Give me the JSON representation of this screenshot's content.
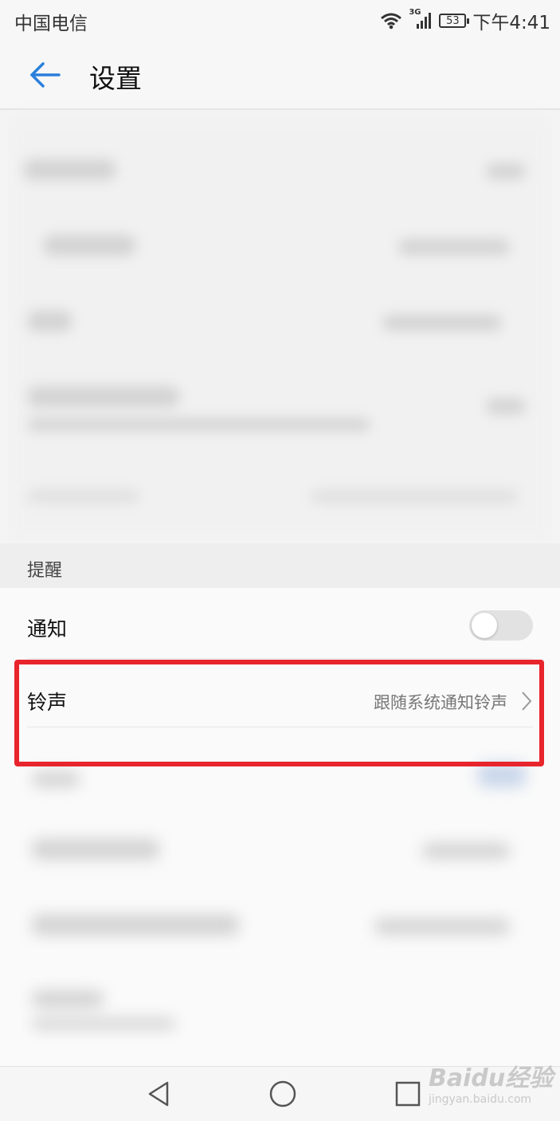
{
  "status_bar": {
    "carrier": "中国电信",
    "network": "3G",
    "battery": "53",
    "time": "下午4:41"
  },
  "header": {
    "title": "设置"
  },
  "reminders": {
    "section_label": "提醒",
    "notification_label": "通知",
    "notification_enabled": false,
    "ringtone_label": "铃声",
    "ringtone_value": "跟随系统通知铃声"
  },
  "highlight_color": "#e8252c",
  "watermark": {
    "logo": "Baidu经验",
    "url": "jingyan.baidu.com"
  },
  "icons": {
    "back": "arrow-left-icon",
    "wifi": "wifi-icon",
    "signal": "signal-icon",
    "battery": "battery-icon",
    "chevron": "chevron-right-icon",
    "nav_back": "triangle-back-icon",
    "nav_home": "circle-home-icon",
    "nav_recent": "square-recent-icon"
  }
}
